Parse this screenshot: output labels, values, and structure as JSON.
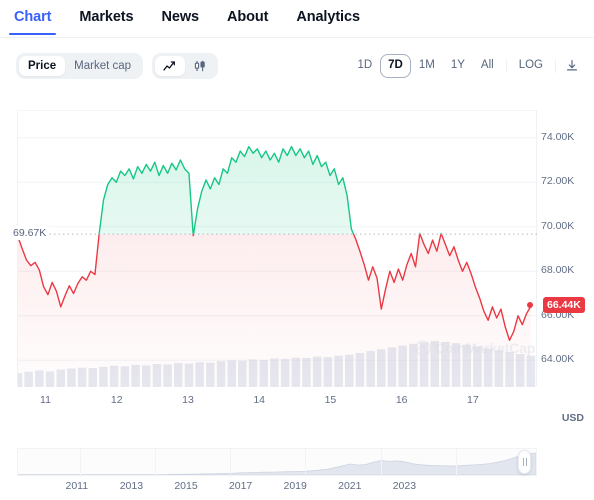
{
  "tabs": [
    {
      "label": "Chart",
      "active": true
    },
    {
      "label": "Markets",
      "active": false
    },
    {
      "label": "News",
      "active": false
    },
    {
      "label": "About",
      "active": false
    },
    {
      "label": "Analytics",
      "active": false
    }
  ],
  "toolbar": {
    "metric_toggle": [
      {
        "label": "Price",
        "active": true
      },
      {
        "label": "Market cap",
        "active": false
      }
    ],
    "charttype_toggle": [
      {
        "icon": "line-chart-icon",
        "active": true
      },
      {
        "icon": "candlestick-chart-icon",
        "active": false
      }
    ],
    "ranges": [
      {
        "label": "1D",
        "active": false
      },
      {
        "label": "7D",
        "active": true
      },
      {
        "label": "1M",
        "active": false
      },
      {
        "label": "1Y",
        "active": false
      },
      {
        "label": "All",
        "active": false
      },
      {
        "label": "LOG",
        "active": false
      }
    ],
    "download_icon": "download-icon"
  },
  "chart_data": {
    "type": "line",
    "title": "",
    "xlabel": "",
    "ylabel": "USD",
    "currency": "USD",
    "xlim": [
      10.6,
      17.9
    ],
    "ylim": [
      62800,
      75200
    ],
    "yticks": [
      74000,
      72000,
      70000,
      68000,
      66000,
      64000
    ],
    "ytick_labels": [
      "74.00K",
      "72.00K",
      "70.00K",
      "68.00K",
      "66.00K",
      "64.00K"
    ],
    "xticks": [
      11,
      12,
      13,
      14,
      15,
      16,
      17
    ],
    "xtick_labels": [
      "11",
      "12",
      "13",
      "14",
      "15",
      "16",
      "17"
    ],
    "grid": true,
    "legend": "none",
    "reference_line": {
      "value": 69670,
      "label": "69.67K",
      "style": "dotted"
    },
    "last_price": {
      "value": 66440,
      "label": "66.44K",
      "color": "#ea3943"
    },
    "colors": {
      "up": "#16c784",
      "down": "#ea3943",
      "volume": "#cfd6e4",
      "accent": "#3861fb"
    },
    "watermark": "CoinMarketCap",
    "series": [
      {
        "name": "Price",
        "x": [
          10.6,
          10.66,
          10.72,
          10.78,
          10.84,
          10.9,
          10.96,
          11.02,
          11.08,
          11.14,
          11.2,
          11.26,
          11.32,
          11.38,
          11.44,
          11.5,
          11.56,
          11.62,
          11.68,
          11.74,
          11.8,
          11.86,
          11.92,
          11.98,
          12.04,
          12.1,
          12.16,
          12.22,
          12.28,
          12.34,
          12.4,
          12.46,
          12.52,
          12.58,
          12.64,
          12.7,
          12.76,
          12.82,
          12.88,
          12.94,
          13.0,
          13.06,
          13.12,
          13.18,
          13.24,
          13.3,
          13.36,
          13.42,
          13.48,
          13.54,
          13.6,
          13.66,
          13.72,
          13.78,
          13.84,
          13.9,
          13.96,
          14.02,
          14.08,
          14.14,
          14.2,
          14.26,
          14.32,
          14.38,
          14.44,
          14.5,
          14.56,
          14.62,
          14.68,
          14.74,
          14.8,
          14.86,
          14.92,
          14.98,
          15.04,
          15.1,
          15.16,
          15.22,
          15.28,
          15.34,
          15.4,
          15.46,
          15.52,
          15.58,
          15.64,
          15.7,
          15.76,
          15.82,
          15.88,
          15.94,
          16.0,
          16.06,
          16.12,
          16.18,
          16.24,
          16.3,
          16.36,
          16.42,
          16.48,
          16.54,
          16.6,
          16.66,
          16.72,
          16.78,
          16.84,
          16.9,
          16.96,
          17.02,
          17.08,
          17.14,
          17.2,
          17.26,
          17.32,
          17.38,
          17.44,
          17.5,
          17.56,
          17.62,
          17.68,
          17.74,
          17.8
        ],
        "y": [
          69550,
          69000,
          68500,
          68250,
          68400,
          68050,
          67300,
          66950,
          67500,
          67100,
          66400,
          66900,
          67350,
          67000,
          67450,
          67750,
          67600,
          68000,
          67850,
          69700,
          71200,
          71900,
          72200,
          72000,
          72500,
          72300,
          72600,
          72150,
          72700,
          72400,
          72800,
          72500,
          72900,
          72300,
          72750,
          72400,
          72850,
          72550,
          73000,
          72600,
          72400,
          69600,
          70800,
          71600,
          72100,
          71700,
          72200,
          71900,
          72600,
          72400,
          73100,
          72900,
          73400,
          73150,
          73600,
          73300,
          73500,
          73100,
          73400,
          73000,
          73300,
          72900,
          73500,
          73200,
          73600,
          73200,
          73500,
          73100,
          73400,
          72800,
          73200,
          72700,
          72900,
          72300,
          72600,
          71900,
          72200,
          71400,
          69900,
          69450,
          68900,
          68300,
          67600,
          68200,
          67700,
          66300,
          67200,
          68000,
          67500,
          68100,
          67600,
          68300,
          68800,
          68200,
          69700,
          69200,
          68800,
          69400,
          68900,
          69700,
          69200,
          68700,
          69100,
          68500,
          68000,
          68400,
          67900,
          67300,
          66800,
          66200,
          65800,
          66400,
          65900,
          66300,
          65500,
          64900,
          65300,
          66000,
          65600,
          66100,
          66440
        ]
      }
    ],
    "volume": {
      "name": "Volume",
      "x": [
        10.6,
        10.75,
        10.9,
        11.05,
        11.2,
        11.35,
        11.5,
        11.65,
        11.8,
        11.95,
        12.1,
        12.25,
        12.4,
        12.55,
        12.7,
        12.85,
        13.0,
        13.15,
        13.3,
        13.45,
        13.6,
        13.75,
        13.9,
        14.05,
        14.2,
        14.35,
        14.5,
        14.65,
        14.8,
        14.95,
        15.1,
        15.25,
        15.4,
        15.55,
        15.7,
        15.85,
        16.0,
        16.15,
        16.3,
        16.45,
        16.6,
        16.75,
        16.9,
        17.05,
        17.2,
        17.35,
        17.5,
        17.65,
        17.8
      ],
      "values": [
        0.3,
        0.33,
        0.36,
        0.34,
        0.38,
        0.4,
        0.42,
        0.41,
        0.44,
        0.46,
        0.45,
        0.48,
        0.47,
        0.5,
        0.49,
        0.52,
        0.51,
        0.54,
        0.53,
        0.56,
        0.58,
        0.57,
        0.6,
        0.59,
        0.62,
        0.61,
        0.64,
        0.63,
        0.66,
        0.65,
        0.68,
        0.7,
        0.74,
        0.78,
        0.82,
        0.86,
        0.9,
        0.94,
        0.97,
        1.0,
        0.98,
        0.95,
        0.92,
        0.88,
        0.84,
        0.8,
        0.76,
        0.72,
        0.68
      ]
    }
  },
  "navigator": {
    "xtick_labels": [
      "2011",
      "2013",
      "2015",
      "2017",
      "2019",
      "2021",
      "2023"
    ],
    "xtick_positions": [
      11.5,
      22.0,
      32.5,
      43.0,
      53.5,
      64.0,
      74.5
    ],
    "handle_position": 97.5,
    "area_values": [
      0.02,
      0.02,
      0.02,
      0.02,
      0.02,
      0.02,
      0.02,
      0.02,
      0.02,
      0.02,
      0.02,
      0.02,
      0.02,
      0.02,
      0.02,
      0.02,
      0.02,
      0.02,
      0.02,
      0.02,
      0.03,
      0.03,
      0.03,
      0.04,
      0.05,
      0.05,
      0.06,
      0.07,
      0.08,
      0.1,
      0.11,
      0.12,
      0.13,
      0.13,
      0.14,
      0.15,
      0.16,
      0.17,
      0.19,
      0.22,
      0.26,
      0.33,
      0.42,
      0.5,
      0.45,
      0.48,
      0.58,
      0.66,
      0.62,
      0.64,
      0.6,
      0.52,
      0.47,
      0.44,
      0.43,
      0.42,
      0.41,
      0.42,
      0.44,
      0.46,
      0.48,
      0.52,
      0.58,
      0.66,
      0.76,
      0.88,
      0.96,
      1.0
    ]
  }
}
